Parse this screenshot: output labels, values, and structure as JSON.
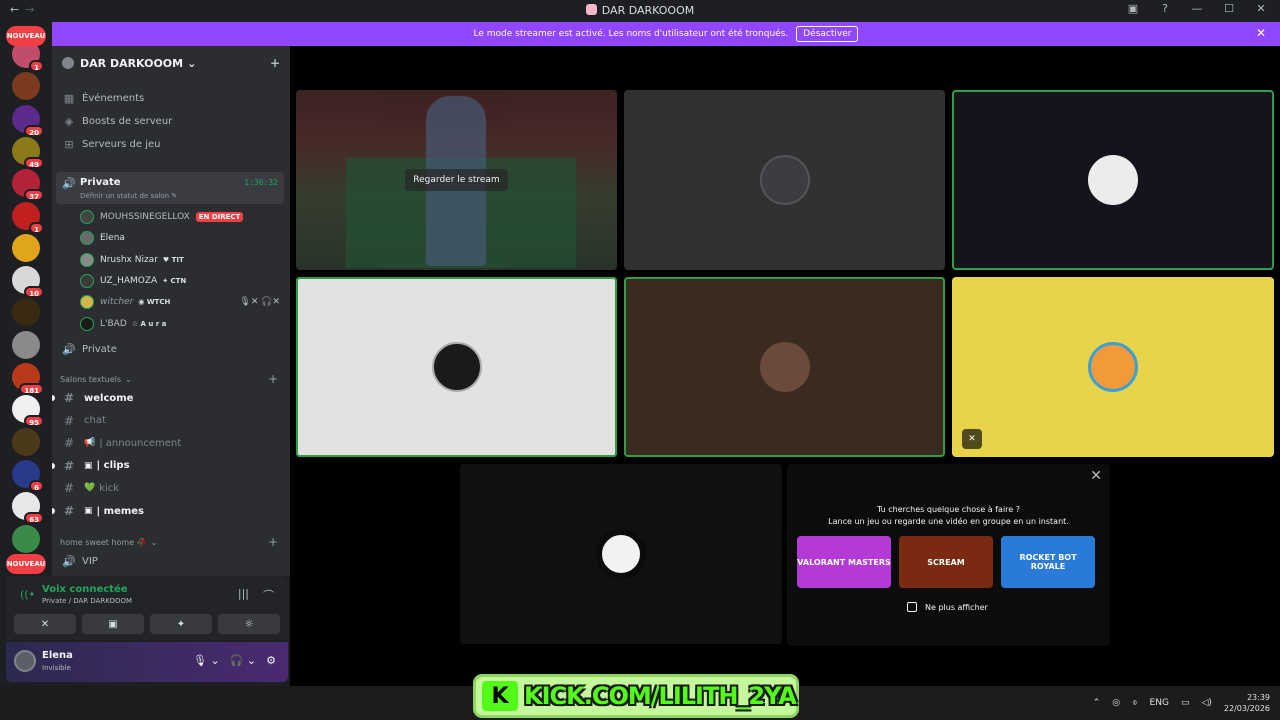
{
  "window": {
    "title": "DAR DARKOOOM",
    "back_icon": "←",
    "forward_icon": "→"
  },
  "rail": {
    "new_label": "NOUVEAU",
    "servers": [
      {
        "color": "#c14d6a",
        "badge": "1"
      },
      {
        "color": "#7a3b1e",
        "badge": ""
      },
      {
        "color": "#5b2a8a",
        "badge": "20"
      },
      {
        "color": "#8a7a1a",
        "badge": "49"
      },
      {
        "color": "#b4223a",
        "badge": "37"
      },
      {
        "color": "#c02020",
        "badge": "1"
      },
      {
        "color": "#e0a51a",
        "badge": ""
      },
      {
        "color": "#d8d8d8",
        "badge": "10"
      },
      {
        "color": "#3a2a12",
        "badge": ""
      },
      {
        "color": "#8a8a8a",
        "badge": ""
      },
      {
        "color": "#b83a1a",
        "badge": "181"
      },
      {
        "color": "#f0f0f0",
        "badge": "95"
      },
      {
        "color": "#4a3a1a",
        "badge": ""
      },
      {
        "color": "#2a3a8a",
        "badge": "6"
      },
      {
        "color": "#e8e8e8",
        "badge": "63"
      },
      {
        "color": "#3a8a4a",
        "badge": ""
      }
    ]
  },
  "banner": {
    "text": "Le mode streamer est activé. Les noms d'utilisateur ont été tronqués.",
    "button": "Désactiver",
    "close_icon": "✕"
  },
  "sidebar": {
    "server_name": "DAR DARKOOOM",
    "chevron": "⌄",
    "invite_icon": "+",
    "nav": [
      {
        "icon": "▦",
        "label": "Événements"
      },
      {
        "icon": "◈",
        "label": "Boosts de serveur"
      },
      {
        "icon": "⊞",
        "label": "Serveurs de jeu"
      }
    ],
    "voice_channel": {
      "icon": "🔊",
      "name": "Private",
      "time": "1:36:32",
      "status": "Définir un statut de salon ✎"
    },
    "members": [
      {
        "name": "MOUHSSINEGELLOX",
        "tag": "",
        "live": "EN DIRECT",
        "mic": "",
        "color": "#444"
      },
      {
        "name": "Elena",
        "tag": "",
        "live": "",
        "mic": "",
        "color": "#6a6a6a"
      },
      {
        "name": "Nrushx Nizar",
        "tag": "♥ TIT",
        "live": "",
        "mic": "",
        "color": "#8a8a8a"
      },
      {
        "name": "UZ_HAMOZA",
        "tag": "✦ CTN",
        "live": "",
        "mic": "",
        "color": "#3a3a3a"
      },
      {
        "name": "witcher",
        "tag": "◉ WTCH",
        "live": "",
        "mic": "🎙✕ 🎧✕",
        "color": "#d6b54a"
      },
      {
        "name": "L'BAD",
        "tag": "☆ A u r a",
        "live": "",
        "mic": "",
        "color": "#1a1a1a"
      }
    ],
    "private2": {
      "icon": "🔊",
      "label": "Private"
    },
    "category1": {
      "label": "Salons textuels",
      "chevron": "⌄",
      "plus": "+"
    },
    "channels": [
      {
        "emoji": "",
        "label": "welcome",
        "unread": true
      },
      {
        "emoji": "",
        "label": "chat",
        "unread": false
      },
      {
        "emoji": "📢",
        "label": "| announcement",
        "unread": false
      },
      {
        "emoji": "▣",
        "label": "| clips",
        "unread": true
      },
      {
        "emoji": "💚",
        "label": "kick",
        "unread": false
      },
      {
        "emoji": "▣",
        "label": "| memes",
        "unread": true
      }
    ],
    "category2": {
      "label": "home sweet home 🥀",
      "chevron": "⌄",
      "plus": "+"
    },
    "vip": {
      "icon": "🔊",
      "label": "VIP"
    },
    "hash": "#"
  },
  "voice_panel": {
    "title": "Voix connectée",
    "subtitle": "Private / DAR DARKOOOM",
    "icons": [
      "|||",
      "⌒"
    ],
    "buttons": [
      "✕",
      "▣",
      "✦",
      "☼"
    ]
  },
  "user_panel": {
    "name": "Elena",
    "status": "Invisible",
    "icons": [
      "🎙 ⌄",
      "🎧 ⌄",
      "⚙"
    ]
  },
  "stage": {
    "stream_button": "Regarder le stream",
    "activity": {
      "close_icon": "✕",
      "line1": "Tu cherches quelque chose à faire ?",
      "line2": "Lance un jeu ou regarde une vidéo en groupe en un instant.",
      "cards": [
        {
          "label": "VALORANT MASTERS",
          "color": "#b43ad8"
        },
        {
          "label": "SCREAM",
          "color": "#7a2a10"
        },
        {
          "label": "ROCKET BOT ROYALE",
          "color": "#2a7ad8"
        }
      ],
      "checkbox_label": "Ne plus afficher"
    },
    "tile_colors": [
      "#2f3133",
      "#14141c",
      "#e2e2e2",
      "#3a2a1f",
      "#e8d44a",
      "#0e1012"
    ]
  },
  "overlay": {
    "kick_logo": "K",
    "kick_text": "KICK.COM/LILITH_2YA"
  },
  "taskbar": {
    "tray_arrow": "⌃",
    "lang": "ENG",
    "time": "23:39",
    "date": "22/03/2026"
  }
}
